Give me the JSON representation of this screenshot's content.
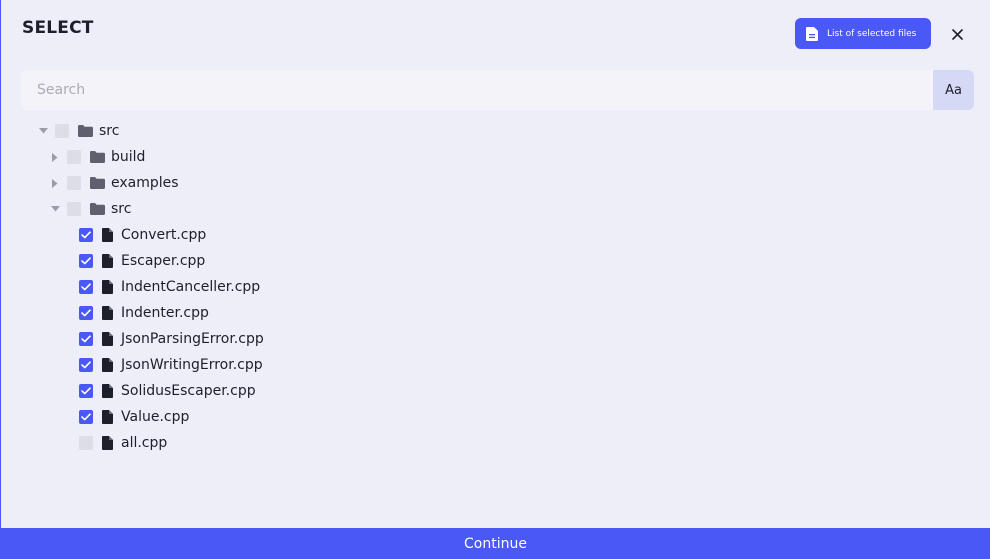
{
  "dialog": {
    "title": "SELECT",
    "selected_files_label": "List of selected files",
    "close_icon": "close-icon"
  },
  "search": {
    "placeholder": "Search",
    "value": "",
    "case_toggle_label": "Aa"
  },
  "tree": [
    {
      "label": "src",
      "type": "folder",
      "expanded": true,
      "checked": false,
      "depth": 0
    },
    {
      "label": "build",
      "type": "folder",
      "expanded": false,
      "checked": false,
      "depth": 1
    },
    {
      "label": "examples",
      "type": "folder",
      "expanded": false,
      "checked": false,
      "depth": 1
    },
    {
      "label": "src",
      "type": "folder",
      "expanded": true,
      "checked": false,
      "depth": 1
    },
    {
      "label": "Convert.cpp",
      "type": "file",
      "checked": true,
      "depth": 2
    },
    {
      "label": "Escaper.cpp",
      "type": "file",
      "checked": true,
      "depth": 2
    },
    {
      "label": "IndentCanceller.cpp",
      "type": "file",
      "checked": true,
      "depth": 2
    },
    {
      "label": "Indenter.cpp",
      "type": "file",
      "checked": true,
      "depth": 2
    },
    {
      "label": "JsonParsingError.cpp",
      "type": "file",
      "checked": true,
      "depth": 2
    },
    {
      "label": "JsonWritingError.cpp",
      "type": "file",
      "checked": true,
      "depth": 2
    },
    {
      "label": "SolidusEscaper.cpp",
      "type": "file",
      "checked": true,
      "depth": 2
    },
    {
      "label": "Value.cpp",
      "type": "file",
      "checked": true,
      "depth": 2
    },
    {
      "label": "all.cpp",
      "type": "file",
      "checked": false,
      "depth": 2
    }
  ],
  "footer": {
    "continue_label": "Continue"
  },
  "colors": {
    "accent": "#4a58f5",
    "background": "#edeef8",
    "checkbox_unchecked": "#dcdde6",
    "text": "#1d1f2b"
  }
}
